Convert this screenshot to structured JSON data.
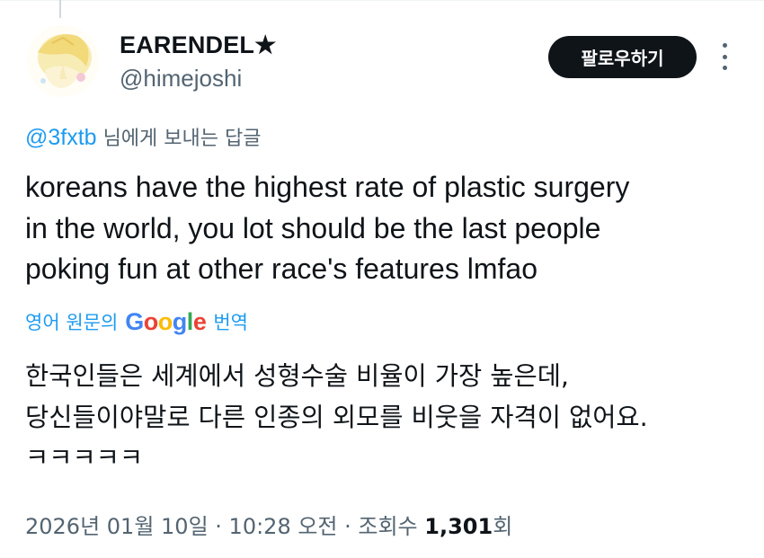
{
  "author": {
    "display_name": "EARENDEL★",
    "handle": "@himejoshi"
  },
  "actions": {
    "follow_label": "팔로우하기",
    "more_icon": "more-vertical-icon"
  },
  "reply": {
    "mention": "@3fxtb",
    "suffix": " 님에게 보내는 답글"
  },
  "tweet": {
    "lines": [
      "koreans have the highest rate of plastic surgery",
      "in the world, you lot should be the last people",
      "poking fun at other race's features lmfao"
    ]
  },
  "translation": {
    "prefix": "영어 원문의",
    "logo": [
      "G",
      "o",
      "o",
      "g",
      "l",
      "e"
    ],
    "action": "번역",
    "lines": [
      "한국인들은 세계에서 성형수술 비율이 가장 높은데,",
      "당신들이야말로 다른 인종의 외모를 비웃을 자격이 없어요.",
      "ㅋㅋㅋㅋㅋ"
    ]
  },
  "meta": {
    "date": "2026년 01월 10일",
    "separator": " · ",
    "time": "10:28 오전",
    "views_label": "조회수 ",
    "views_count": "1,301",
    "views_suffix": "회"
  },
  "colors": {
    "accent": "#1d9bf0",
    "text": "#0f1419",
    "secondary": "#536471",
    "button_bg": "#0f1419"
  }
}
